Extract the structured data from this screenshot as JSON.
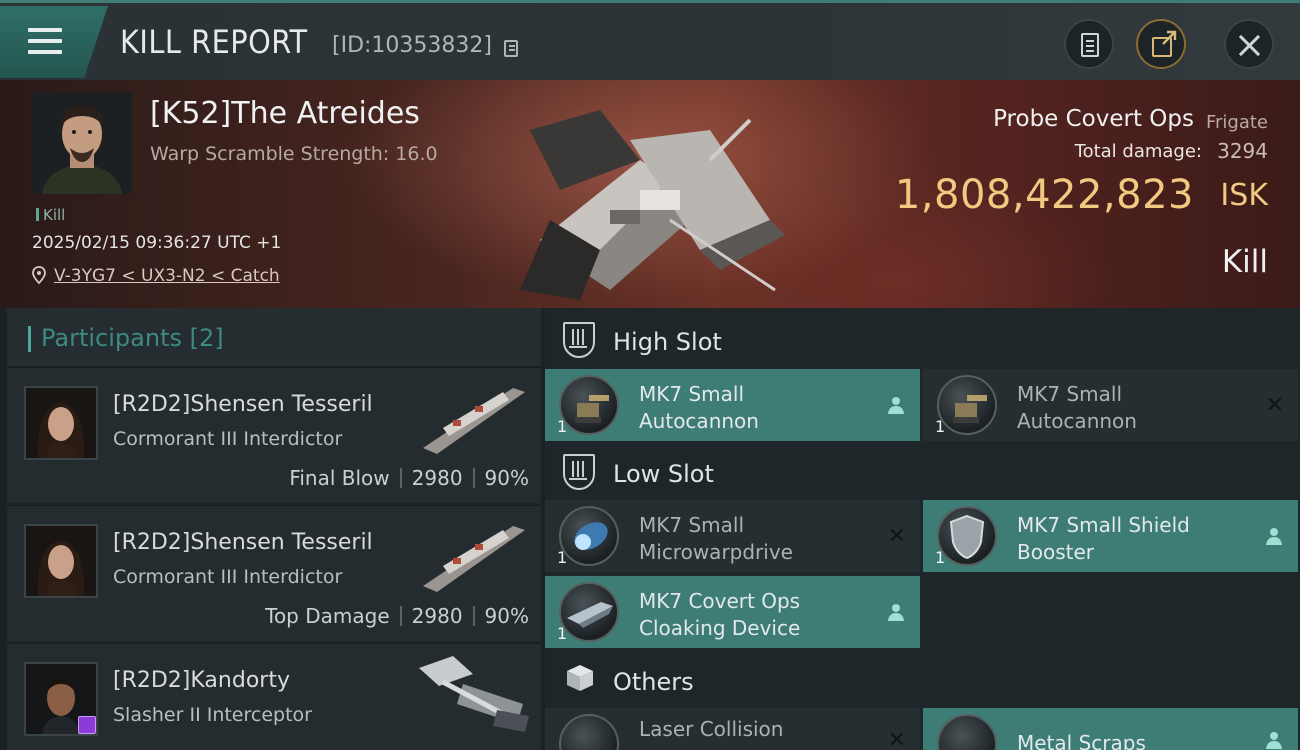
{
  "header": {
    "title": "KILL REPORT",
    "report_id": "[ID:10353832]"
  },
  "victim": {
    "name": "[K52]The Atreides",
    "scramble": "Warp Scramble Strength: 16.0",
    "tag": "Kill",
    "datetime": "2025/02/15 09:36:27 UTC +1",
    "location": "V-3YG7 < UX3-N2 < Catch"
  },
  "ship": {
    "name": "Probe Covert Ops",
    "class": "Frigate",
    "total_damage_label": "Total damage:",
    "total_damage": "3294",
    "isk_value": "1,808,422,823",
    "isk_unit": "ISK",
    "result": "Kill"
  },
  "participants": {
    "label": "Participants",
    "count": "[2]",
    "rows": [
      {
        "name": "[R2D2]Shensen Tesseril",
        "ship": "Cormorant III Interdictor",
        "role": "Final Blow",
        "damage": "2980",
        "percent": "90%"
      },
      {
        "name": "[R2D2]Shensen Tesseril",
        "ship": "Cormorant III Interdictor",
        "role": "Top Damage",
        "damage": "2980",
        "percent": "90%"
      },
      {
        "name": "[R2D2]Kandorty",
        "ship": "Slasher II Interceptor"
      }
    ]
  },
  "fitting": {
    "high_slot": "High Slot",
    "low_slot": "Low Slot",
    "others": "Others",
    "high": [
      {
        "qty": "1",
        "line1": "MK7 Small",
        "line2": "Autocannon"
      },
      {
        "qty": "1",
        "line1": "MK7 Small",
        "line2": "Autocannon"
      }
    ],
    "low": [
      {
        "qty": "1",
        "line1": "MK7 Small",
        "line2": "Microwarpdrive"
      },
      {
        "qty": "1",
        "line1": "MK7 Small Shield",
        "line2": "Booster"
      },
      {
        "qty": "1",
        "line1": "MK7 Covert Ops",
        "line2": "Cloaking Device"
      }
    ],
    "other": [
      {
        "line1": "Laser Collision"
      },
      {
        "line1": "Metal Scraps"
      }
    ]
  },
  "colors": {
    "accent": "#3e7d76",
    "isk": "#f1c980",
    "teal_text": "#3d8a82"
  }
}
